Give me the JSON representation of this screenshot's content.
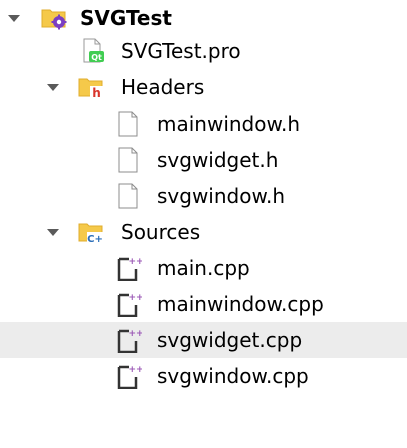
{
  "tree": {
    "project": {
      "name": "SVGTest",
      "icon": "project-folder-gear-icon",
      "expanded": true,
      "children": {
        "pro_file": {
          "name": "SVGTest.pro",
          "icon": "qt-project-file-icon"
        },
        "headers": {
          "name": "Headers",
          "icon": "headers-folder-icon",
          "expanded": true,
          "files": [
            {
              "name": "mainwindow.h",
              "icon": "header-file-icon"
            },
            {
              "name": "svgwidget.h",
              "icon": "header-file-icon"
            },
            {
              "name": "svgwindow.h",
              "icon": "header-file-icon"
            }
          ]
        },
        "sources": {
          "name": "Sources",
          "icon": "sources-folder-icon",
          "expanded": true,
          "files": [
            {
              "name": "main.cpp",
              "icon": "cpp-file-icon",
              "selected": false
            },
            {
              "name": "mainwindow.cpp",
              "icon": "cpp-file-icon",
              "selected": false
            },
            {
              "name": "svgwidget.cpp",
              "icon": "cpp-file-icon",
              "selected": true
            },
            {
              "name": "svgwindow.cpp",
              "icon": "cpp-file-icon",
              "selected": false
            }
          ]
        }
      }
    }
  },
  "colors": {
    "folder": "#f5c94a",
    "folder_dark": "#e0ad2c",
    "gear": "#7b3fc2",
    "headers_badge": "#d9342b",
    "cpp_badge": "#2a6db8",
    "qt_green": "#41cd52",
    "selection": "#ececec",
    "plus_marks": "#9b59b6"
  }
}
